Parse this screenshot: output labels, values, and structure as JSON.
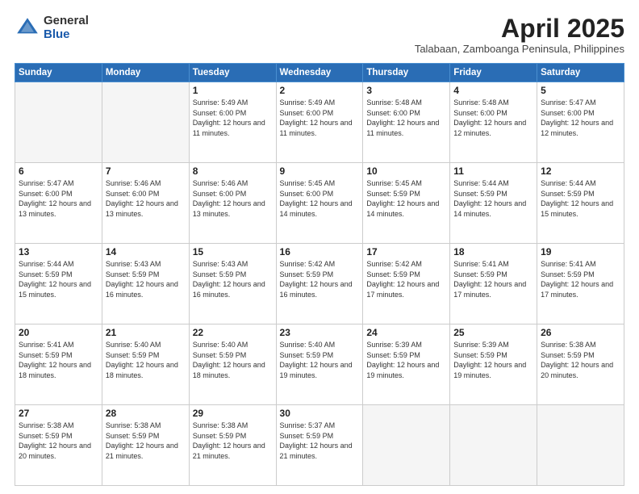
{
  "logo": {
    "general": "General",
    "blue": "Blue"
  },
  "title": "April 2025",
  "subtitle": "Talabaan, Zamboanga Peninsula, Philippines",
  "headers": [
    "Sunday",
    "Monday",
    "Tuesday",
    "Wednesday",
    "Thursday",
    "Friday",
    "Saturday"
  ],
  "weeks": [
    [
      {
        "day": "",
        "info": ""
      },
      {
        "day": "",
        "info": ""
      },
      {
        "day": "1",
        "info": "Sunrise: 5:49 AM\nSunset: 6:00 PM\nDaylight: 12 hours and 11 minutes."
      },
      {
        "day": "2",
        "info": "Sunrise: 5:49 AM\nSunset: 6:00 PM\nDaylight: 12 hours and 11 minutes."
      },
      {
        "day": "3",
        "info": "Sunrise: 5:48 AM\nSunset: 6:00 PM\nDaylight: 12 hours and 11 minutes."
      },
      {
        "day": "4",
        "info": "Sunrise: 5:48 AM\nSunset: 6:00 PM\nDaylight: 12 hours and 12 minutes."
      },
      {
        "day": "5",
        "info": "Sunrise: 5:47 AM\nSunset: 6:00 PM\nDaylight: 12 hours and 12 minutes."
      }
    ],
    [
      {
        "day": "6",
        "info": "Sunrise: 5:47 AM\nSunset: 6:00 PM\nDaylight: 12 hours and 13 minutes."
      },
      {
        "day": "7",
        "info": "Sunrise: 5:46 AM\nSunset: 6:00 PM\nDaylight: 12 hours and 13 minutes."
      },
      {
        "day": "8",
        "info": "Sunrise: 5:46 AM\nSunset: 6:00 PM\nDaylight: 12 hours and 13 minutes."
      },
      {
        "day": "9",
        "info": "Sunrise: 5:45 AM\nSunset: 6:00 PM\nDaylight: 12 hours and 14 minutes."
      },
      {
        "day": "10",
        "info": "Sunrise: 5:45 AM\nSunset: 5:59 PM\nDaylight: 12 hours and 14 minutes."
      },
      {
        "day": "11",
        "info": "Sunrise: 5:44 AM\nSunset: 5:59 PM\nDaylight: 12 hours and 14 minutes."
      },
      {
        "day": "12",
        "info": "Sunrise: 5:44 AM\nSunset: 5:59 PM\nDaylight: 12 hours and 15 minutes."
      }
    ],
    [
      {
        "day": "13",
        "info": "Sunrise: 5:44 AM\nSunset: 5:59 PM\nDaylight: 12 hours and 15 minutes."
      },
      {
        "day": "14",
        "info": "Sunrise: 5:43 AM\nSunset: 5:59 PM\nDaylight: 12 hours and 16 minutes."
      },
      {
        "day": "15",
        "info": "Sunrise: 5:43 AM\nSunset: 5:59 PM\nDaylight: 12 hours and 16 minutes."
      },
      {
        "day": "16",
        "info": "Sunrise: 5:42 AM\nSunset: 5:59 PM\nDaylight: 12 hours and 16 minutes."
      },
      {
        "day": "17",
        "info": "Sunrise: 5:42 AM\nSunset: 5:59 PM\nDaylight: 12 hours and 17 minutes."
      },
      {
        "day": "18",
        "info": "Sunrise: 5:41 AM\nSunset: 5:59 PM\nDaylight: 12 hours and 17 minutes."
      },
      {
        "day": "19",
        "info": "Sunrise: 5:41 AM\nSunset: 5:59 PM\nDaylight: 12 hours and 17 minutes."
      }
    ],
    [
      {
        "day": "20",
        "info": "Sunrise: 5:41 AM\nSunset: 5:59 PM\nDaylight: 12 hours and 18 minutes."
      },
      {
        "day": "21",
        "info": "Sunrise: 5:40 AM\nSunset: 5:59 PM\nDaylight: 12 hours and 18 minutes."
      },
      {
        "day": "22",
        "info": "Sunrise: 5:40 AM\nSunset: 5:59 PM\nDaylight: 12 hours and 18 minutes."
      },
      {
        "day": "23",
        "info": "Sunrise: 5:40 AM\nSunset: 5:59 PM\nDaylight: 12 hours and 19 minutes."
      },
      {
        "day": "24",
        "info": "Sunrise: 5:39 AM\nSunset: 5:59 PM\nDaylight: 12 hours and 19 minutes."
      },
      {
        "day": "25",
        "info": "Sunrise: 5:39 AM\nSunset: 5:59 PM\nDaylight: 12 hours and 19 minutes."
      },
      {
        "day": "26",
        "info": "Sunrise: 5:38 AM\nSunset: 5:59 PM\nDaylight: 12 hours and 20 minutes."
      }
    ],
    [
      {
        "day": "27",
        "info": "Sunrise: 5:38 AM\nSunset: 5:59 PM\nDaylight: 12 hours and 20 minutes."
      },
      {
        "day": "28",
        "info": "Sunrise: 5:38 AM\nSunset: 5:59 PM\nDaylight: 12 hours and 21 minutes."
      },
      {
        "day": "29",
        "info": "Sunrise: 5:38 AM\nSunset: 5:59 PM\nDaylight: 12 hours and 21 minutes."
      },
      {
        "day": "30",
        "info": "Sunrise: 5:37 AM\nSunset: 5:59 PM\nDaylight: 12 hours and 21 minutes."
      },
      {
        "day": "",
        "info": ""
      },
      {
        "day": "",
        "info": ""
      },
      {
        "day": "",
        "info": ""
      }
    ]
  ]
}
